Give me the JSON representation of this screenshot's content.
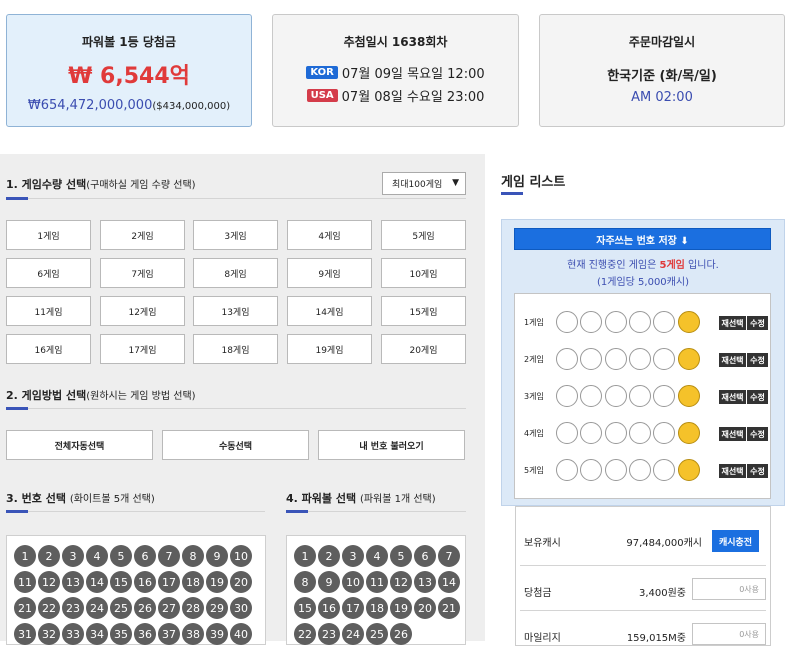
{
  "jackpot": {
    "title": "파워볼 1등 당첨금",
    "amount": "₩ 6,544억",
    "won": "₩654,472,000,000",
    "usd": "($434,000,000)"
  },
  "draw": {
    "title": "추첨일시 1638회차",
    "kor_flag": "KOR",
    "kor_time": "07월 09일 목요일 12:00",
    "usa_flag": "USA",
    "usa_time": "07월 08일 수요일 23:00"
  },
  "close": {
    "title": "주문마감일시",
    "line1": "한국기준 (화/목/일)",
    "line2": "AM 02:00"
  },
  "section1": {
    "title": "1. 게임수량 선택",
    "sub": "(구매하실 게임 수량 선택)",
    "select_value": "최대100게임"
  },
  "game_counts": [
    "1게임",
    "2게임",
    "3게임",
    "4게임",
    "5게임",
    "6게임",
    "7게임",
    "8게임",
    "9게임",
    "10게임",
    "11게임",
    "12게임",
    "13게임",
    "14게임",
    "15게임",
    "16게임",
    "17게임",
    "18게임",
    "19게임",
    "20게임"
  ],
  "section2": {
    "title": "2. 게임방법 선택",
    "sub": "(원하시는 게임 방법 선택)",
    "btn_auto": "전체자동선택",
    "btn_manual": "수동선택",
    "btn_load": "내 번호 불러오기"
  },
  "section3": {
    "title": "3. 번호 선택",
    "sub": "(화이트볼 5개 선택)"
  },
  "section4": {
    "title": "4. 파워볼 선택",
    "sub": "(파워볼 1개 선택)"
  },
  "white_numbers": [
    "1",
    "2",
    "3",
    "4",
    "5",
    "6",
    "7",
    "8",
    "9",
    "10",
    "11",
    "12",
    "13",
    "14",
    "15",
    "16",
    "17",
    "18",
    "19",
    "20",
    "21",
    "22",
    "23",
    "24",
    "25",
    "26",
    "27",
    "28",
    "29",
    "30",
    "31",
    "32",
    "33",
    "34",
    "35",
    "36",
    "37",
    "38",
    "39",
    "40"
  ],
  "power_numbers": [
    "1",
    "2",
    "3",
    "4",
    "5",
    "6",
    "7",
    "8",
    "9",
    "10",
    "11",
    "12",
    "13",
    "14",
    "15",
    "16",
    "17",
    "18",
    "19",
    "20",
    "21",
    "22",
    "23",
    "24",
    "25",
    "26"
  ],
  "game_list": {
    "title": "게임 리스트",
    "fav_button": "자주쓰는 번호 저장 ⬇",
    "info_prefix": "현재 진행중인 게임은 ",
    "info_count": "5게임",
    "info_suffix": " 입니다.",
    "price": "(1게임당 5,000캐시)",
    "rows": [
      {
        "label": "1게임",
        "reselect": "재선택",
        "edit": "수정"
      },
      {
        "label": "2게임",
        "reselect": "재선택",
        "edit": "수정"
      },
      {
        "label": "3게임",
        "reselect": "재선택",
        "edit": "수정"
      },
      {
        "label": "4게임",
        "reselect": "재선택",
        "edit": "수정"
      },
      {
        "label": "5게임",
        "reselect": "재선택",
        "edit": "수정"
      }
    ]
  },
  "account": {
    "cash_label": "보유캐시",
    "cash_value": "97,484,000캐시",
    "charge_button": "캐시충전",
    "prize_label": "당첨금",
    "prize_value": "3,400원중",
    "prize_use": "0사용",
    "mileage_label": "마일리지",
    "mileage_value": "159,015M중",
    "mileage_use": "0사용"
  }
}
